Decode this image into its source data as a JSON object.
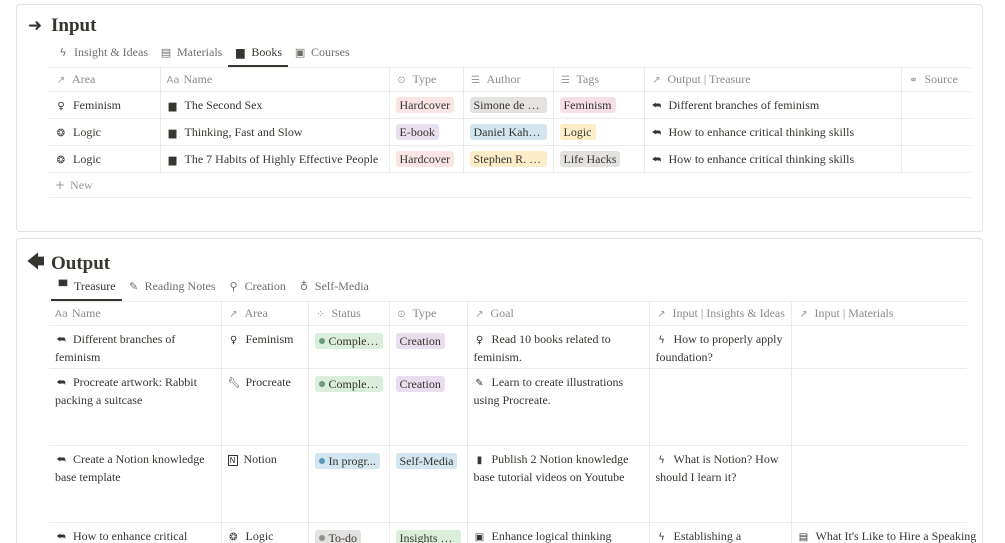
{
  "input": {
    "title": "Input",
    "arrow_icon": "right-arrow-icon",
    "tabs": [
      {
        "label": "Insight & Ideas",
        "icon": "bolt-icon"
      },
      {
        "label": "Materials",
        "icon": "document-icon"
      },
      {
        "label": "Books",
        "icon": "book-icon",
        "active": true
      },
      {
        "label": "Courses",
        "icon": "course-icon"
      }
    ],
    "columns": [
      "Area",
      "Name",
      "Type",
      "Author",
      "Tags",
      "Output | Treasure",
      "Source"
    ],
    "rows": [
      {
        "area": "Feminism",
        "area_icon": "person-icon",
        "name": "The Second Sex",
        "type": "Hardcover",
        "author": "Simone de B...",
        "tag": "Feminism",
        "output": "Different branches of feminism",
        "source": ""
      },
      {
        "area": "Logic",
        "area_icon": "brain-icon",
        "name": "Thinking, Fast and Slow",
        "type": "E-book",
        "author": "Daniel Kahn...",
        "tag": "Logic",
        "output": "How to enhance critical thinking skills",
        "source": ""
      },
      {
        "area": "Logic",
        "area_icon": "brain-icon",
        "name": "The 7 Habits of Highly Effective People",
        "type": "Hardcover",
        "author": "Stephen R. C...",
        "tag": "Life Hacks",
        "output": "How to enhance critical thinking skills",
        "source": ""
      }
    ],
    "new_label": "New"
  },
  "output": {
    "title": "Output",
    "arrow_icon": "left-arrow-icon",
    "tabs": [
      {
        "label": "Treasure",
        "icon": "treasure-icon",
        "active": true
      },
      {
        "label": "Reading Notes",
        "icon": "pencil-icon"
      },
      {
        "label": "Creation",
        "icon": "lightbulb-icon"
      },
      {
        "label": "Self-Media",
        "icon": "microphone-icon"
      }
    ],
    "columns": [
      "Name",
      "Area",
      "Status",
      "Type",
      "Goal",
      "Input | Insights & Ideas",
      "Input | Materials"
    ],
    "rows": [
      {
        "name": "Different branches of feminism",
        "area": "Feminism",
        "area_icon": "person-icon",
        "status": "Complet...",
        "status_kind": "complete",
        "type": "Creation",
        "goal": "Read 10 books related to feminism.",
        "goal_icon": "person-icon",
        "insight": "How to properly apply foundation?",
        "material": ""
      },
      {
        "name": "Procreate artwork: Rabbit packing a suitcase",
        "area": "Procreate",
        "area_icon": "wrench-icon",
        "status": "Complet...",
        "status_kind": "complete",
        "type": "Creation",
        "goal": "Learn to create illustrations using Procreate.",
        "goal_icon": "brush-icon",
        "insight": "",
        "material": ""
      },
      {
        "name": "Create a Notion knowledge base template",
        "area": "Notion",
        "area_icon": "notion-icon",
        "status": "In progr...",
        "status_kind": "progress",
        "type": "Self-Media",
        "goal": "Publish 2 Notion knowledge base tutorial videos on Youtube",
        "goal_icon": "bookmark-icon",
        "insight": "What is Notion? How should I learn it?",
        "material": ""
      },
      {
        "name": "How to enhance critical",
        "area": "Logic",
        "area_icon": "brain-icon",
        "status": "To-do",
        "status_kind": "todo",
        "type": "Insights & ...",
        "goal": "Enhance logical thinking skills.",
        "goal_icon": "chart-icon",
        "insight": "Establishing a",
        "material": "What It's Like to Hire a Speaking"
      }
    ]
  },
  "colors": {
    "hardcover_bg": "#fbe4e4",
    "ebook_bg": "#e8deee",
    "author_simone_bg": "#e3e2e0",
    "author_daniel_bg": "#d3e5ef",
    "author_stephen_bg": "#fdecc8",
    "tag_feminism_bg": "#f5e0e9",
    "tag_logic_bg": "#fdecc8",
    "tag_lifehacks_bg": "#e3e2e0",
    "complete_bg": "#dbeddb",
    "complete_dot": "#6c9b7d",
    "progress_bg": "#d3e5ef",
    "progress_dot": "#5b97bd",
    "todo_bg": "#e3e2e0",
    "todo_dot": "#91918e",
    "creation_bg": "#e8deee",
    "selfmedia_bg": "#d3e5ef",
    "insights_bg": "#dbeddb"
  }
}
